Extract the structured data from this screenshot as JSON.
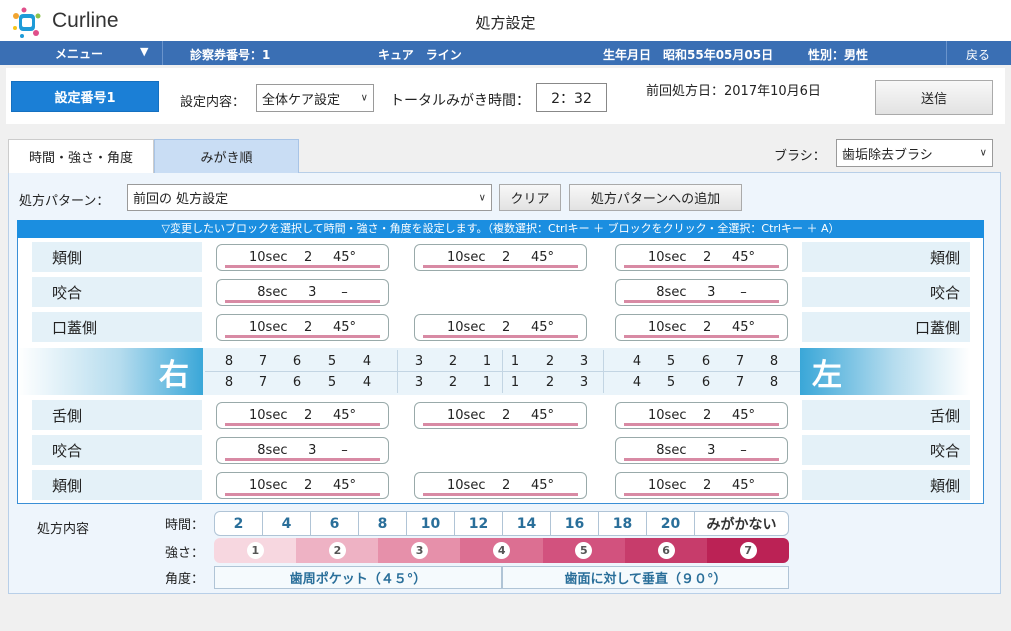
{
  "app": {
    "logo_text": "Curline",
    "window_title": "処方設定"
  },
  "infobar": {
    "menu_label": "メニュー",
    "menu_arrow": "▼",
    "exam_no": "診察券番号：1",
    "patient_name": "キュア　ライン",
    "birthdate": "生年月日　昭和55年05月05日",
    "gender": "性別：男性",
    "back_label": "戻る"
  },
  "settings": {
    "setting_no_label": "設定番号1",
    "content_label": "設定内容：",
    "content_value": "全体ケア設定",
    "total_time_label": "トータルみがき時間：",
    "total_time_value": "2：32",
    "prev_date": "前回処方日：2017年10月6日",
    "send_label": "送信"
  },
  "tabs": [
    {
      "label": "時間・強さ・角度",
      "active": true
    },
    {
      "label": "みがき順",
      "active": false
    }
  ],
  "brush": {
    "label": "ブラシ：",
    "value": "歯垢除去ブラシ"
  },
  "pattern": {
    "label": "処方パターン：",
    "value": "前回の 処方設定",
    "clear_label": "クリア",
    "add_label": "処方パターンへの追加"
  },
  "instruction": "▽変更したいブロックを選択して時間・強さ・角度を設定します。（複数選択：Ctrlキー ＋ ブロックをクリック・全選択：Ctrlキー ＋ A）",
  "upper_rows": [
    {
      "left_label": "頬側",
      "right_label": "頬側",
      "blocks": [
        "10sec    2     45°",
        "10sec    2     45°",
        "10sec    2     45°"
      ]
    },
    {
      "left_label": "咬合",
      "right_label": "咬合",
      "blocks": [
        "8sec     3      –",
        "",
        "8sec     3      –"
      ]
    },
    {
      "left_label": "口蓋側",
      "right_label": "口蓋側",
      "blocks": [
        "10sec    2     45°",
        "10sec    2     45°",
        "10sec    2     45°"
      ]
    }
  ],
  "lower_rows": [
    {
      "left_label": "舌側",
      "right_label": "舌側",
      "blocks": [
        "10sec    2     45°",
        "10sec    2     45°",
        "10sec    2     45°"
      ]
    },
    {
      "left_label": "咬合",
      "right_label": "咬合",
      "blocks": [
        "8sec     3      –",
        "",
        "8sec     3      –"
      ]
    },
    {
      "left_label": "頬側",
      "right_label": "頬側",
      "blocks": [
        "10sec    2     45°",
        "10sec    2     45°",
        "10sec    2     45°"
      ]
    }
  ],
  "jaw": {
    "right_label": "右",
    "left_label": "左",
    "teeth_groups": [
      [
        "8",
        "7",
        "6",
        "5",
        "4"
      ],
      [
        "3",
        "2",
        "1"
      ],
      [
        "1",
        "2",
        "3"
      ],
      [
        "4",
        "5",
        "6",
        "7",
        "8"
      ]
    ]
  },
  "prescription": {
    "title": "処方内容",
    "time_label": "時間：",
    "times": [
      "2",
      "4",
      "6",
      "8",
      "10",
      "12",
      "14",
      "16",
      "18",
      "20",
      "みがかない"
    ],
    "strength_label": "強さ：",
    "strengths": [
      "1",
      "2",
      "3",
      "4",
      "5",
      "6",
      "7"
    ],
    "strength_colors": [
      "#f7d7e0",
      "#eeb2c4",
      "#e690aa",
      "#dc6f92",
      "#d2527e",
      "#c73c6b",
      "#bb2255"
    ],
    "angle_label": "角度：",
    "angles": [
      "歯周ポケット（４５°）",
      "歯面に対して垂直（９０°）"
    ]
  },
  "colors": {
    "accent": "#1b7fd6",
    "infobar": "#3a6fb4",
    "instruction_bar": "#1b8ee0"
  }
}
